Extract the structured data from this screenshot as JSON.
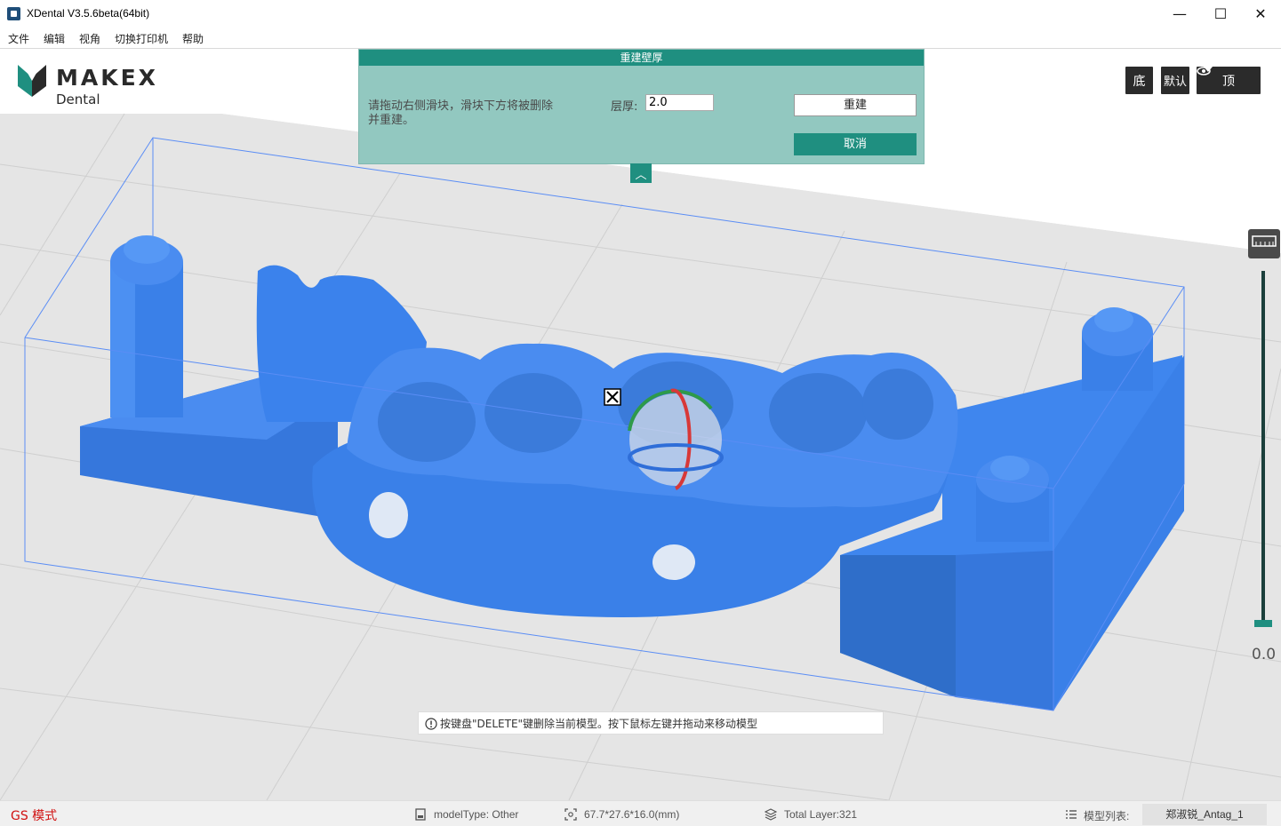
{
  "window": {
    "title": "XDental V3.5.6beta(64bit)",
    "minimize_glyph": "—",
    "maximize_glyph": "☐",
    "close_glyph": "✕"
  },
  "menu": [
    "文件",
    "编辑",
    "视角",
    "切换打印机",
    "帮助"
  ],
  "logo": {
    "text": "MAKEX",
    "sub": "Dental"
  },
  "panel": {
    "title": "重建壁厚",
    "instruction": "请拖动右侧滑块，滑块下方将被删除并重建。",
    "layer_label": "层厚:",
    "layer_value": "2.0",
    "rebuild_label": "重建",
    "cancel_label": "取消",
    "collapse_glyph": "︿"
  },
  "view_buttons": {
    "bottom": "底",
    "default": "默认",
    "top": "顶"
  },
  "slider": {
    "value": "0.0",
    "fraction": 0
  },
  "hint": "按键盘\"DELETE\"键删除当前模型。按下鼠标左键并拖动来移动模型",
  "status": {
    "mode": "GS 模式",
    "model_type": "modelType: Other",
    "dimensions": "67.7*27.6*16.0(mm)",
    "total_layer": "Total Layer:321",
    "model_list_label": "模型列表:",
    "model_name": "郑淑锐_Antag_1"
  },
  "colors": {
    "accent": "#1f8f80",
    "panel_bg": "#92c8c0",
    "model_blue": "#3c87ea",
    "status_red": "#d01010"
  }
}
